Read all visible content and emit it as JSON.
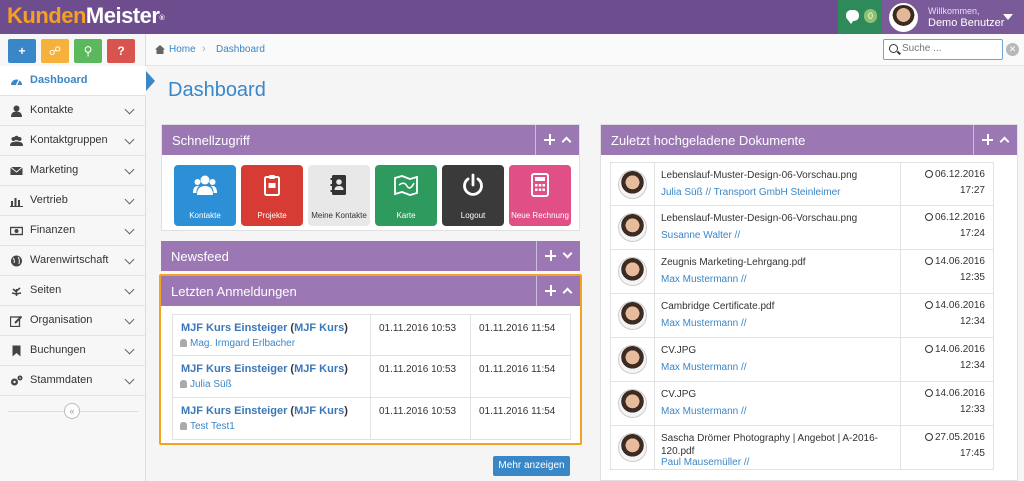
{
  "app": {
    "logo_part1": "Kunden",
    "logo_part2": "Meister",
    "logo_reg": "®"
  },
  "header": {
    "chat_count": "0",
    "welcome": "Willkommen,",
    "username": "Demo Benutzer"
  },
  "quick_buttons": [
    {
      "label": "+",
      "color": "#3a87c8"
    },
    {
      "label": "☍",
      "color": "#f6b13b"
    },
    {
      "label": "⚲",
      "color": "#5cb85c"
    },
    {
      "label": "?",
      "color": "#d9534f"
    }
  ],
  "sidebar": {
    "items": [
      {
        "label": "Dashboard"
      },
      {
        "label": "Kontakte"
      },
      {
        "label": "Kontaktgruppen"
      },
      {
        "label": "Marketing"
      },
      {
        "label": "Vertrieb"
      },
      {
        "label": "Finanzen"
      },
      {
        "label": "Warenwirtschaft"
      },
      {
        "label": "Seiten"
      },
      {
        "label": "Organisation"
      },
      {
        "label": "Buchungen"
      },
      {
        "label": "Stammdaten"
      }
    ],
    "collapse": "«"
  },
  "breadcrumb": {
    "home": "Home",
    "sep": "›",
    "current": "Dashboard"
  },
  "search": {
    "placeholder": "Suche ..."
  },
  "page": {
    "title": "Dashboard"
  },
  "panels": {
    "quick_title": "Schnellzugriff",
    "news_title": "Newsfeed",
    "logins_title": "Letzten Anmeldungen",
    "docs_title": "Zuletzt hochgeladene Dokumente",
    "more_button": "Mehr anzeigen"
  },
  "tiles": [
    {
      "label": "Kontakte",
      "color": "#2d8fd6"
    },
    {
      "label": "Projekte",
      "color": "#d63c33"
    },
    {
      "label": "Meine Kontakte",
      "color": "#e8e8e8"
    },
    {
      "label": "Karte",
      "color": "#2e9a5e"
    },
    {
      "label": "Logout",
      "color": "#3a3a3a"
    },
    {
      "label": "Neue Rechnung",
      "color": "#e04f85"
    }
  ],
  "logins": [
    {
      "course": "MJF Kurs Einsteiger",
      "type": "MJF Kurs",
      "person": "Mag. Irmgard Erlbacher",
      "start": "01.11.2016 10:53",
      "end": "01.11.2016 11:54"
    },
    {
      "course": "MJF Kurs Einsteiger",
      "type": "MJF Kurs",
      "person": "Julia Süß",
      "start": "01.11.2016 10:53",
      "end": "01.11.2016 11:54"
    },
    {
      "course": "MJF Kurs Einsteiger",
      "type": "MJF Kurs",
      "person": "Test Test1",
      "start": "01.11.2016 10:53",
      "end": "01.11.2016 11:54"
    }
  ],
  "documents": [
    {
      "file": "Lebenslauf-Muster-Design-06-Vorschau.png",
      "uploader": "Julia Süß // Transport GmbH Steinleimer",
      "date": "06.12.2016",
      "time": "17:27"
    },
    {
      "file": "Lebenslauf-Muster-Design-06-Vorschau.png",
      "uploader": "Susanne Walter //",
      "date": "06.12.2016",
      "time": "17:24"
    },
    {
      "file": "Zeugnis Marketing-Lehrgang.pdf",
      "uploader": "Max Mustermann //",
      "date": "14.06.2016",
      "time": "12:35"
    },
    {
      "file": "Cambridge Certificate.pdf",
      "uploader": "Max Mustermann //",
      "date": "14.06.2016",
      "time": "12:34"
    },
    {
      "file": "CV.JPG",
      "uploader": "Max Mustermann //",
      "date": "14.06.2016",
      "time": "12:34"
    },
    {
      "file": "CV.JPG",
      "uploader": "Max Mustermann //",
      "date": "14.06.2016",
      "time": "12:33"
    },
    {
      "file": "Sascha Drömer Photography | Angebot | A-2016-120.pdf",
      "uploader": "Paul Mausemüller //",
      "date": "27.05.2016",
      "time": "17:45"
    }
  ]
}
